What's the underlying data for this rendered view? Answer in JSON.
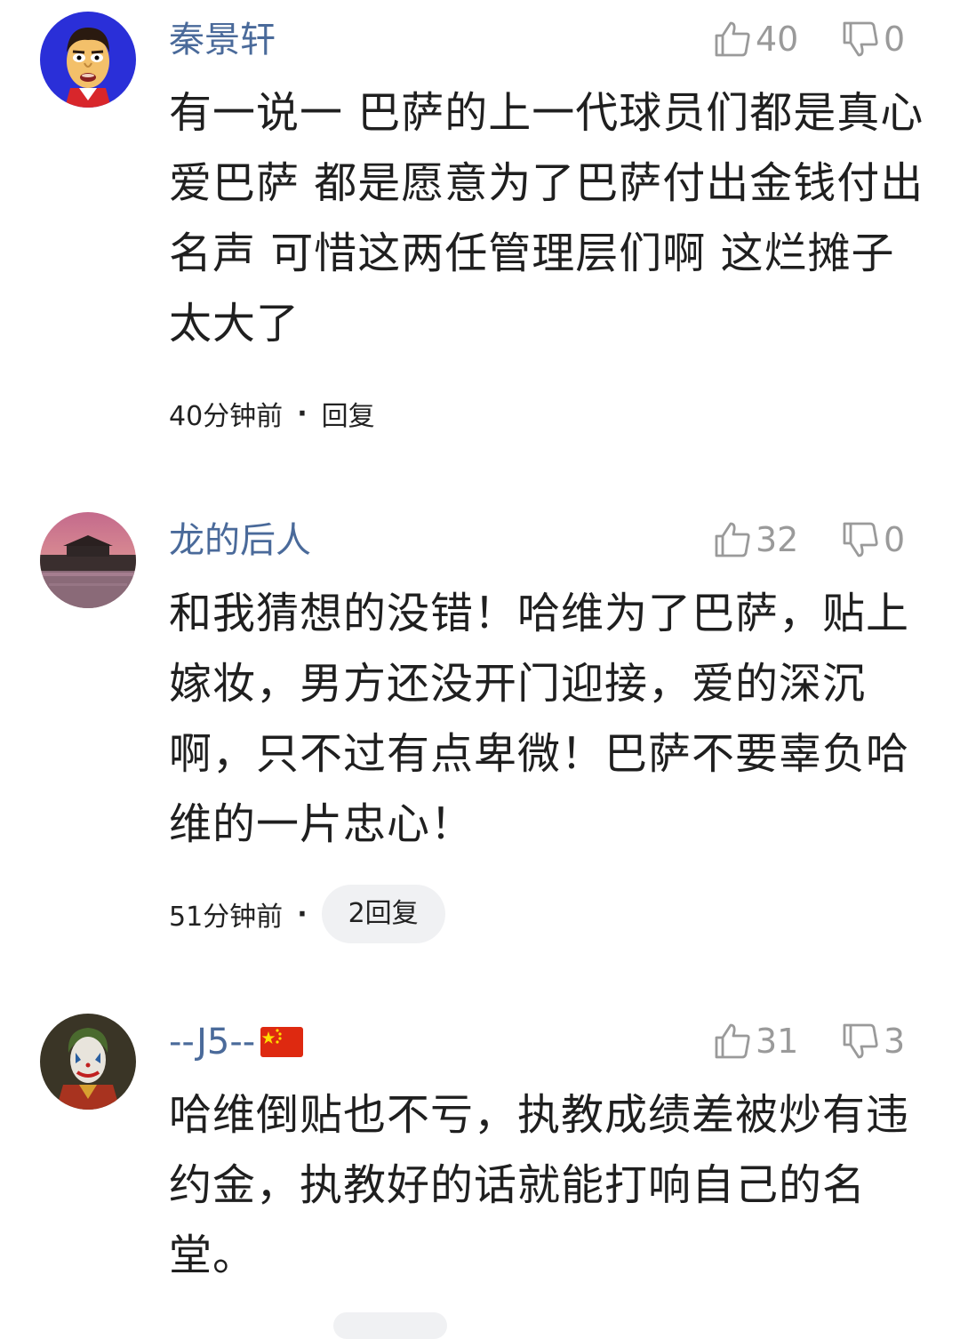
{
  "comments": [
    {
      "username": "秦景轩",
      "likes": "40",
      "dislikes": "0",
      "text": "有一说一 巴萨的上一代球员们都是真心爱巴萨 都是愿意为了巴萨付出金钱付出名声 可惜这两任管理层们啊 这烂摊子太大了",
      "time": "40分钟前",
      "separator": "·",
      "reply_label": "回复",
      "avatar_icon": "cartoon-face-avatar"
    },
    {
      "username": "龙的后人",
      "likes": "32",
      "dislikes": "0",
      "text": "和我猜想的没错！哈维为了巴萨，贴上嫁妆，男方还没开门迎接，爱的深沉啊，只不过有点卑微！巴萨不要辜负哈维的一片忠心！",
      "time": "51分钟前",
      "separator": "·",
      "reply_label": "2回复",
      "avatar_icon": "palace-sunset-avatar"
    },
    {
      "username": "--J5--",
      "likes": "31",
      "dislikes": "3",
      "text": "哈维倒贴也不亏，执教成绩差被炒有违约金，执教好的话就能打响自己的名堂。",
      "avatar_icon": "joker-avatar",
      "flag_icon": "china-flag-emoji"
    }
  ],
  "colors": {
    "username": "#4a6a9a",
    "vote": "#9a9a9a",
    "pill_bg": "#f0f1f3",
    "text": "#1f1f1f"
  }
}
